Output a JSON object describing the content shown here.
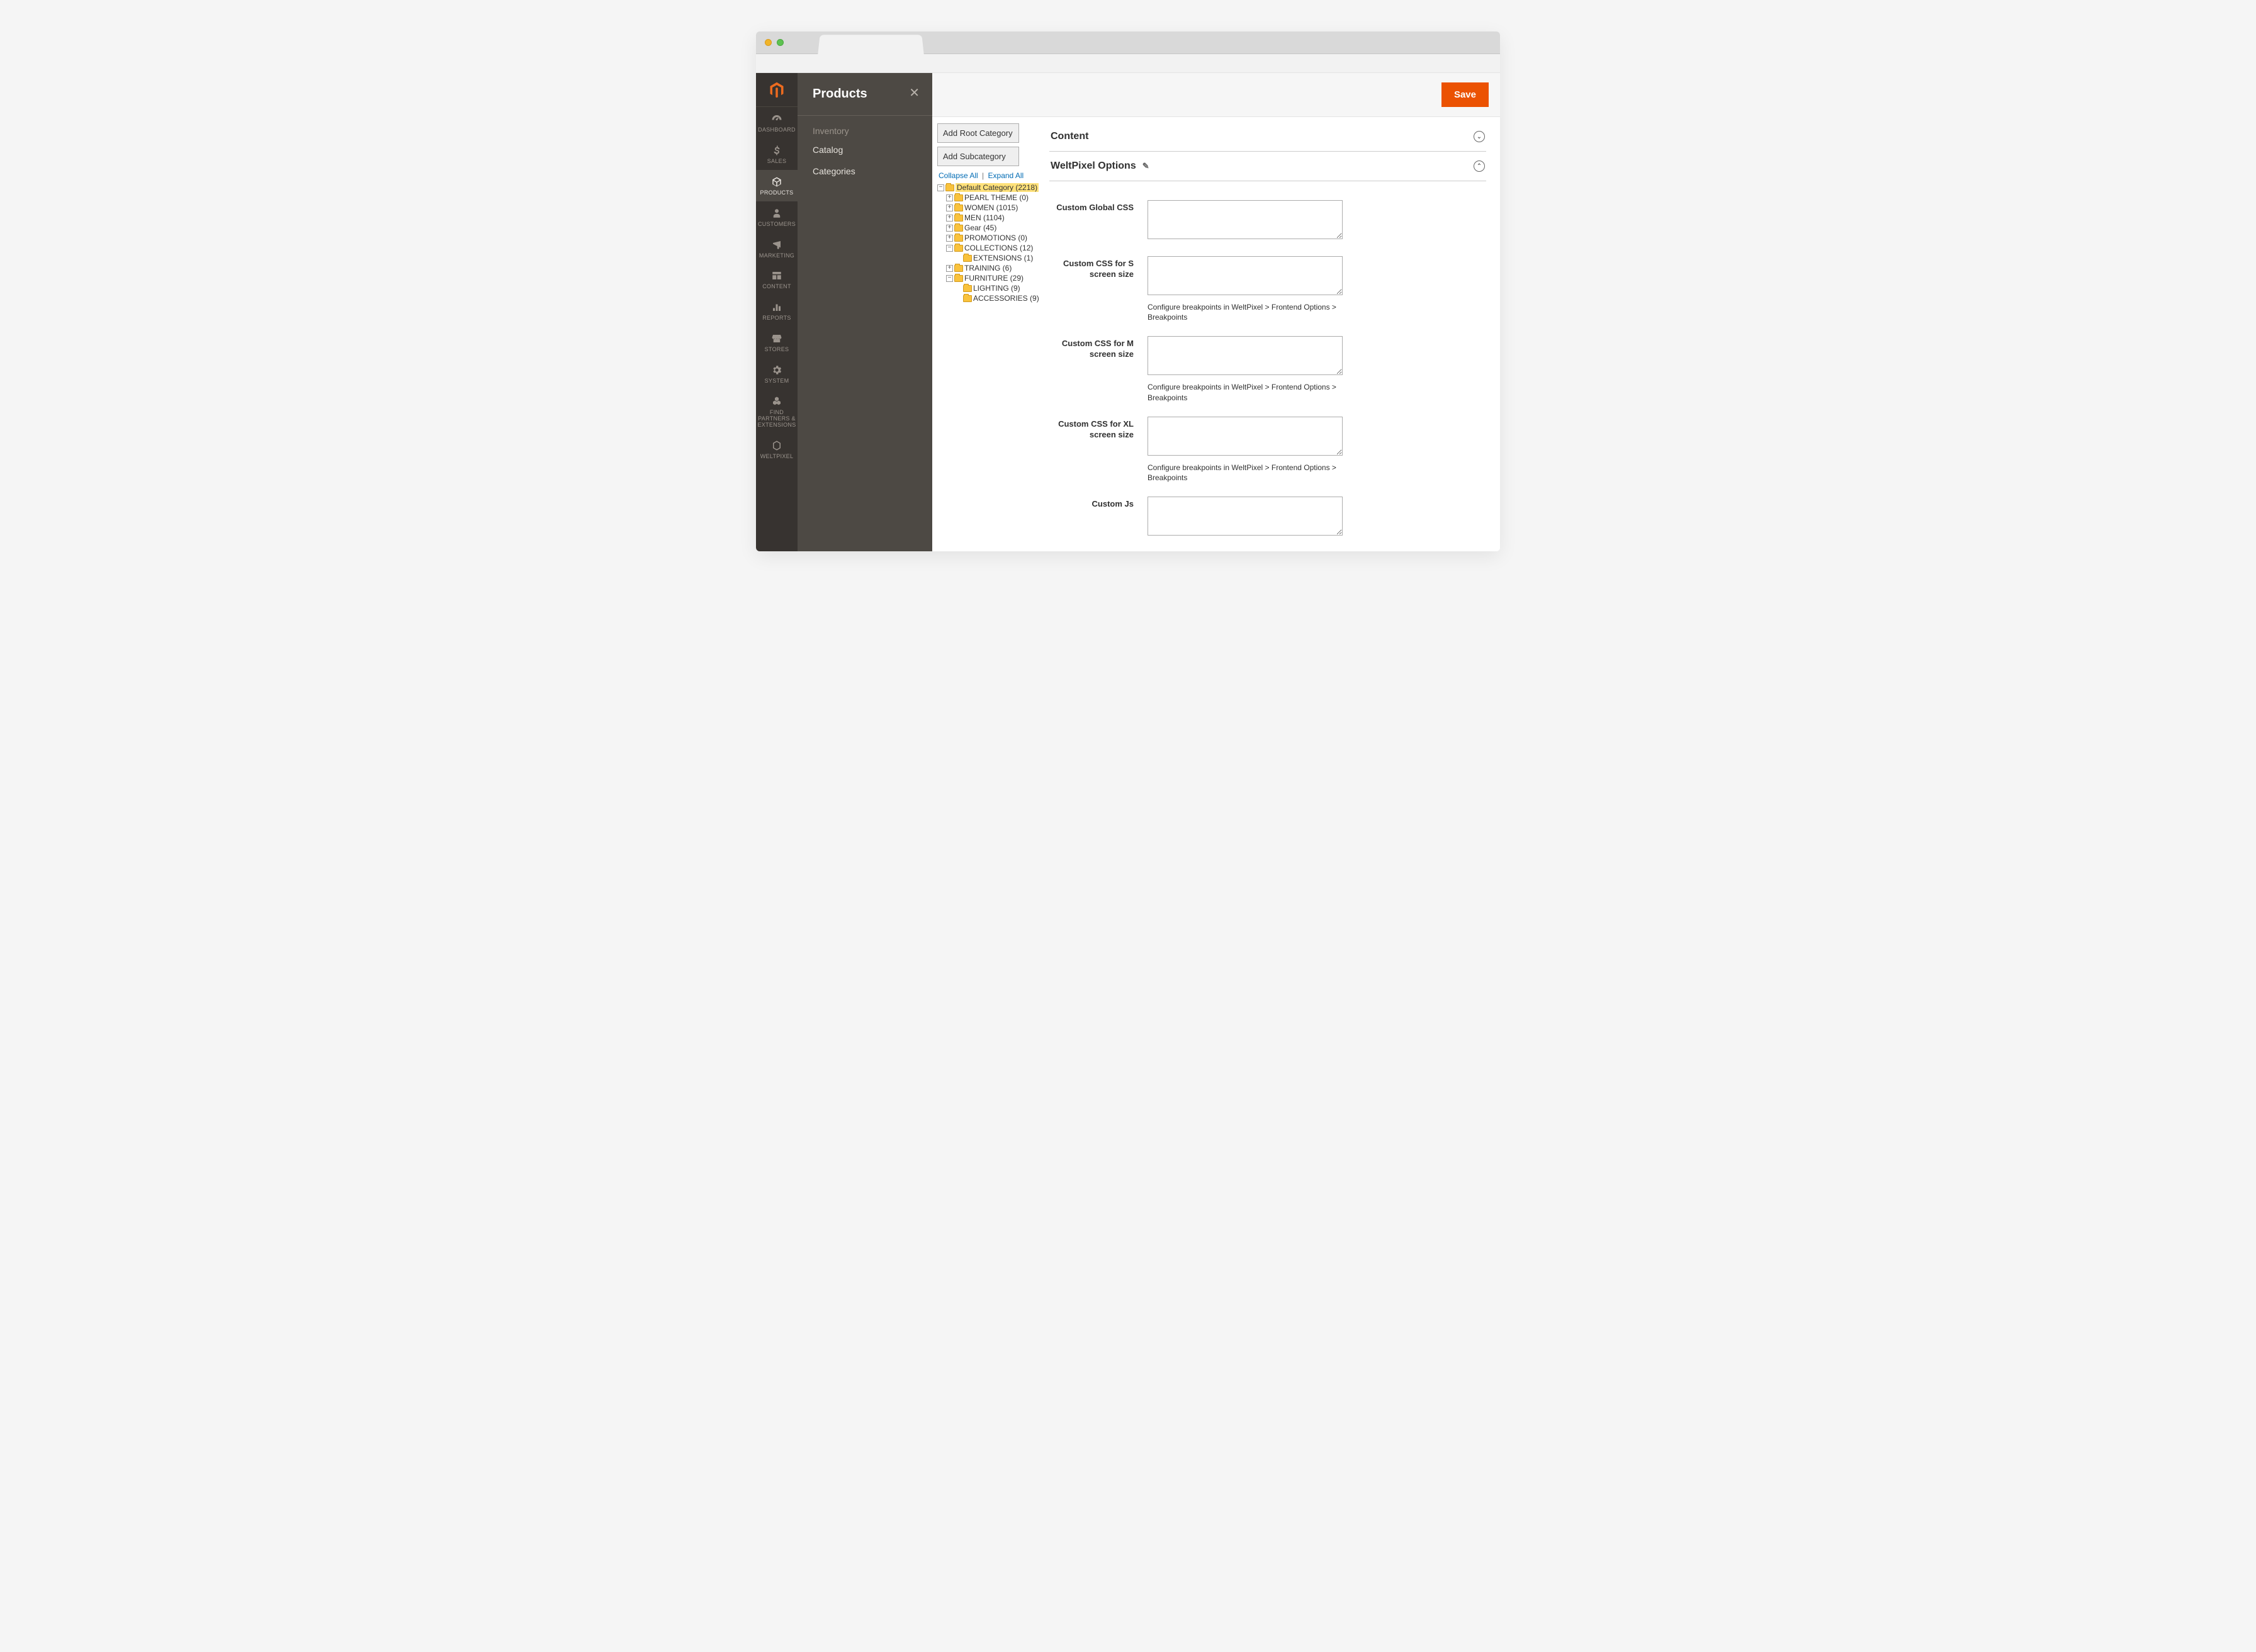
{
  "rail": {
    "items": [
      {
        "label": "DASHBOARD"
      },
      {
        "label": "SALES"
      },
      {
        "label": "PRODUCTS"
      },
      {
        "label": "CUSTOMERS"
      },
      {
        "label": "MARKETING"
      },
      {
        "label": "CONTENT"
      },
      {
        "label": "REPORTS"
      },
      {
        "label": "STORES"
      },
      {
        "label": "SYSTEM"
      },
      {
        "label": "FIND PARTNERS & EXTENSIONS"
      },
      {
        "label": "WELTPIXEL"
      }
    ]
  },
  "submenu": {
    "title": "Products",
    "group": "Inventory",
    "links": [
      "Catalog",
      "Categories"
    ]
  },
  "topbar": {
    "save": "Save"
  },
  "tree": {
    "add_root": "Add Root Category",
    "add_sub": "Add Subcategory",
    "collapse": "Collapse All",
    "expand": "Expand All",
    "root": "Default Category (2218)",
    "nodes": [
      "PEARL THEME (0)",
      "WOMEN (1015)",
      "MEN (1104)",
      "Gear (45)",
      "PROMOTIONS (0)",
      "COLLECTIONS (12)",
      "EXTENSIONS (1)",
      "TRAINING (6)",
      "FURNITURE (29)",
      "LIGHTING (9)",
      "ACCESSORIES (9)"
    ]
  },
  "sections": {
    "content": "Content",
    "weltpixel": "WeltPixel Options"
  },
  "fields": {
    "global": "Custom Global CSS",
    "s": "Custom CSS for S screen size",
    "m": "Custom CSS for M screen size",
    "xl": "Custom CSS for XL screen size",
    "js": "Custom Js",
    "hint": "Configure breakpoints in WeltPixel > Frontend Options > Breakpoints"
  }
}
